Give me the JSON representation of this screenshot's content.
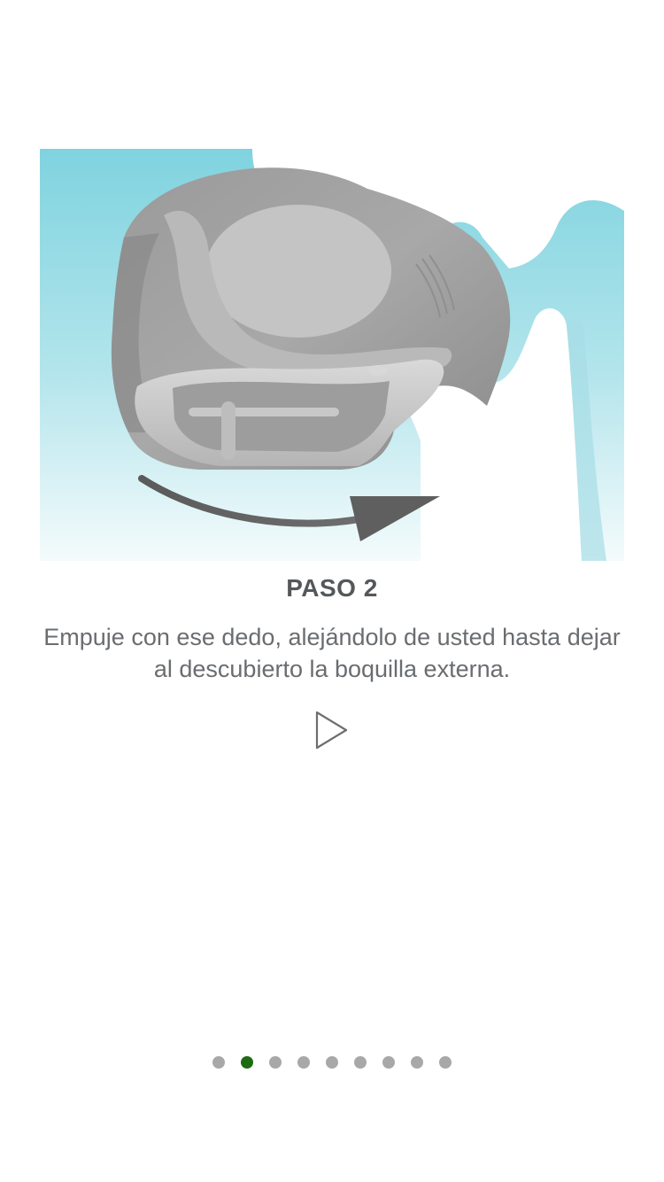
{
  "step": {
    "title": "PASO 2",
    "description": "Empuje con ese dedo, alejándolo de usted hasta dejar al descubierto la boquilla externa."
  },
  "media": {
    "play_icon": "play-icon",
    "illustration": "inhaler-mouthpiece-illustration"
  },
  "pager": {
    "total": 9,
    "active_index": 1,
    "active_color": "#1f6b12",
    "inactive_color": "#a8a8a8"
  },
  "colors": {
    "background": "#ffffff",
    "title": "#55585b",
    "text": "#6a6d70",
    "illustration_sky": "#7fd3df"
  }
}
